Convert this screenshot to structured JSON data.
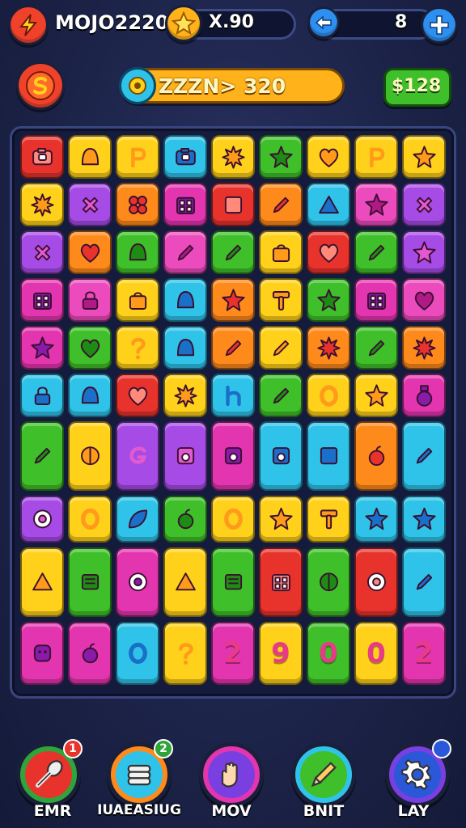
{
  "hud": {
    "player_name": "MOJO2220",
    "multiplier": "X.90",
    "moves": "8",
    "level_banner": "ZZZN> 320",
    "score": "$128"
  },
  "colors": {
    "red": "#e8332d",
    "yellow": "#ffd11a",
    "green": "#3fbf2a",
    "cyan": "#2fc3ea",
    "pink": "#ec4bbd",
    "purple": "#a64be6",
    "orange": "#ff8a1c",
    "magenta": "#e335b0"
  },
  "board": {
    "rows": [
      [
        {
          "c": "red",
          "i": "camera-icon"
        },
        {
          "c": "yellow",
          "i": "bell-icon"
        },
        {
          "c": "yellow",
          "i": "p-icon"
        },
        {
          "c": "cyan",
          "i": "camera-icon"
        },
        {
          "c": "yellow",
          "i": "splat-icon"
        },
        {
          "c": "green",
          "i": "star-icon"
        },
        {
          "c": "yellow",
          "i": "heart-icon"
        },
        {
          "c": "yellow",
          "i": "p-icon"
        },
        {
          "c": "yellow",
          "i": "star-icon"
        }
      ],
      [
        {
          "c": "yellow",
          "i": "splat-icon"
        },
        {
          "c": "purple",
          "i": "cross-icon"
        },
        {
          "c": "orange",
          "i": "clover-icon"
        },
        {
          "c": "magenta",
          "i": "grid-icon"
        },
        {
          "c": "red",
          "i": "square-icon"
        },
        {
          "c": "orange",
          "i": "pencil-icon"
        },
        {
          "c": "cyan",
          "i": "triangle-icon"
        },
        {
          "c": "pink",
          "i": "star-icon"
        },
        {
          "c": "purple",
          "i": "cross-icon"
        }
      ],
      [
        {
          "c": "purple",
          "i": "cross-icon"
        },
        {
          "c": "orange",
          "i": "heart-icon"
        },
        {
          "c": "green",
          "i": "bell-icon"
        },
        {
          "c": "pink",
          "i": "pencil-icon"
        },
        {
          "c": "green",
          "i": "pencil-icon"
        },
        {
          "c": "yellow",
          "i": "bag-icon"
        },
        {
          "c": "red",
          "i": "heart-icon"
        },
        {
          "c": "green",
          "i": "pencil-icon"
        },
        {
          "c": "purple",
          "i": "star-icon"
        }
      ],
      [
        {
          "c": "magenta",
          "i": "grid-icon"
        },
        {
          "c": "pink",
          "i": "lock-icon"
        },
        {
          "c": "yellow",
          "i": "bag-icon"
        },
        {
          "c": "cyan",
          "i": "bell-icon"
        },
        {
          "c": "orange",
          "i": "star-icon"
        },
        {
          "c": "yellow",
          "i": "hammer-icon"
        },
        {
          "c": "green",
          "i": "star-icon"
        },
        {
          "c": "magenta",
          "i": "grid-icon"
        },
        {
          "c": "pink",
          "i": "heart-icon"
        }
      ],
      [
        {
          "c": "magenta",
          "i": "star-icon"
        },
        {
          "c": "green",
          "i": "heart-icon"
        },
        {
          "c": "yellow",
          "i": "question-icon"
        },
        {
          "c": "cyan",
          "i": "bell-icon"
        },
        {
          "c": "orange",
          "i": "pencil-icon"
        },
        {
          "c": "yellow",
          "i": "pencil-icon"
        },
        {
          "c": "orange",
          "i": "splat-icon"
        },
        {
          "c": "green",
          "i": "pencil-icon"
        },
        {
          "c": "orange",
          "i": "splat-icon"
        }
      ],
      [
        {
          "c": "cyan",
          "i": "lock-icon"
        },
        {
          "c": "cyan",
          "i": "bell-icon"
        },
        {
          "c": "red",
          "i": "heart-icon"
        },
        {
          "c": "yellow",
          "i": "splat-icon"
        },
        {
          "c": "cyan",
          "i": "h-icon"
        },
        {
          "c": "green",
          "i": "pencil-icon"
        },
        {
          "c": "yellow",
          "i": "ring-icon"
        },
        {
          "c": "yellow",
          "i": "star-icon"
        },
        {
          "c": "magenta",
          "i": "bottle-icon"
        }
      ]
    ],
    "tall_rows": [
      [
        {
          "c": "green",
          "i": "pencil-icon"
        },
        {
          "c": "yellow",
          "i": "ball-icon"
        },
        {
          "c": "purple",
          "i": "g-icon"
        },
        {
          "c": "purple",
          "i": "disk-icon"
        },
        {
          "c": "magenta",
          "i": "disk-icon"
        },
        {
          "c": "cyan",
          "i": "disk-icon"
        },
        {
          "c": "cyan",
          "i": "square-icon"
        },
        {
          "c": "orange",
          "i": "apple-icon"
        },
        {
          "c": "cyan",
          "i": "pencil-icon"
        }
      ],
      [
        {
          "c": "purple",
          "i": "dial-icon"
        },
        {
          "c": "yellow",
          "i": "ring-icon"
        },
        {
          "c": "cyan",
          "i": "leaf-icon"
        },
        {
          "c": "green",
          "i": "apple-icon"
        },
        {
          "c": "yellow",
          "i": "ring-icon"
        },
        {
          "c": "yellow",
          "i": "star-icon"
        },
        {
          "c": "yellow",
          "i": "hammer-icon"
        },
        {
          "c": "cyan",
          "i": "star-icon"
        },
        {
          "c": "cyan",
          "i": "star-icon"
        }
      ],
      [
        {
          "c": "yellow",
          "i": "triangle-icon"
        },
        {
          "c": "green",
          "i": "box-icon"
        },
        {
          "c": "magenta",
          "i": "dial-icon"
        },
        {
          "c": "yellow",
          "i": "triangle-icon"
        },
        {
          "c": "green",
          "i": "box-icon"
        },
        {
          "c": "red",
          "i": "grid-icon"
        },
        {
          "c": "green",
          "i": "ball-icon"
        },
        {
          "c": "red",
          "i": "dial-icon"
        },
        {
          "c": "cyan",
          "i": "pencil-icon"
        }
      ],
      [
        {
          "c": "magenta",
          "i": "face-icon"
        },
        {
          "c": "magenta",
          "i": "apple-icon"
        },
        {
          "c": "cyan",
          "i": "ring-icon"
        },
        {
          "c": "yellow",
          "i": "question-icon"
        },
        {
          "c": "magenta",
          "i": "digit-2"
        },
        {
          "c": "yellow",
          "i": "digit-9"
        },
        {
          "c": "green",
          "i": "digit-0"
        },
        {
          "c": "yellow",
          "i": "digit-0"
        },
        {
          "c": "magenta",
          "i": "digit-2"
        }
      ]
    ],
    "digits": {
      "digit-2": "2",
      "digit-9": "9",
      "digit-0": "0"
    }
  },
  "tools": [
    {
      "label": "EMR",
      "badge": "1",
      "ring": "#2fa43a",
      "inner": "#e8332d",
      "icon": "spoon-icon",
      "badge_color": "#e8332d"
    },
    {
      "label": "IUAEASIUG",
      "badge": "2",
      "ring": "#ff8a1c",
      "inner": "#2fc3ea",
      "icon": "scrolls-icon",
      "badge_color": "#2fa43a"
    },
    {
      "label": "MOV",
      "badge": "",
      "ring": "#e335b0",
      "inner": "#7a3fe0",
      "icon": "hand-icon",
      "badge_color": ""
    },
    {
      "label": "BNIT",
      "badge": "",
      "ring": "#2fc3ea",
      "inner": "#3fbf2a",
      "icon": "pencil-tool-icon",
      "badge_color": ""
    },
    {
      "label": "LAY",
      "badge": "",
      "ring": "#7a3fe0",
      "inner": "#2b58d8",
      "icon": "gear-icon",
      "badge_color": "#2b58d8"
    }
  ]
}
